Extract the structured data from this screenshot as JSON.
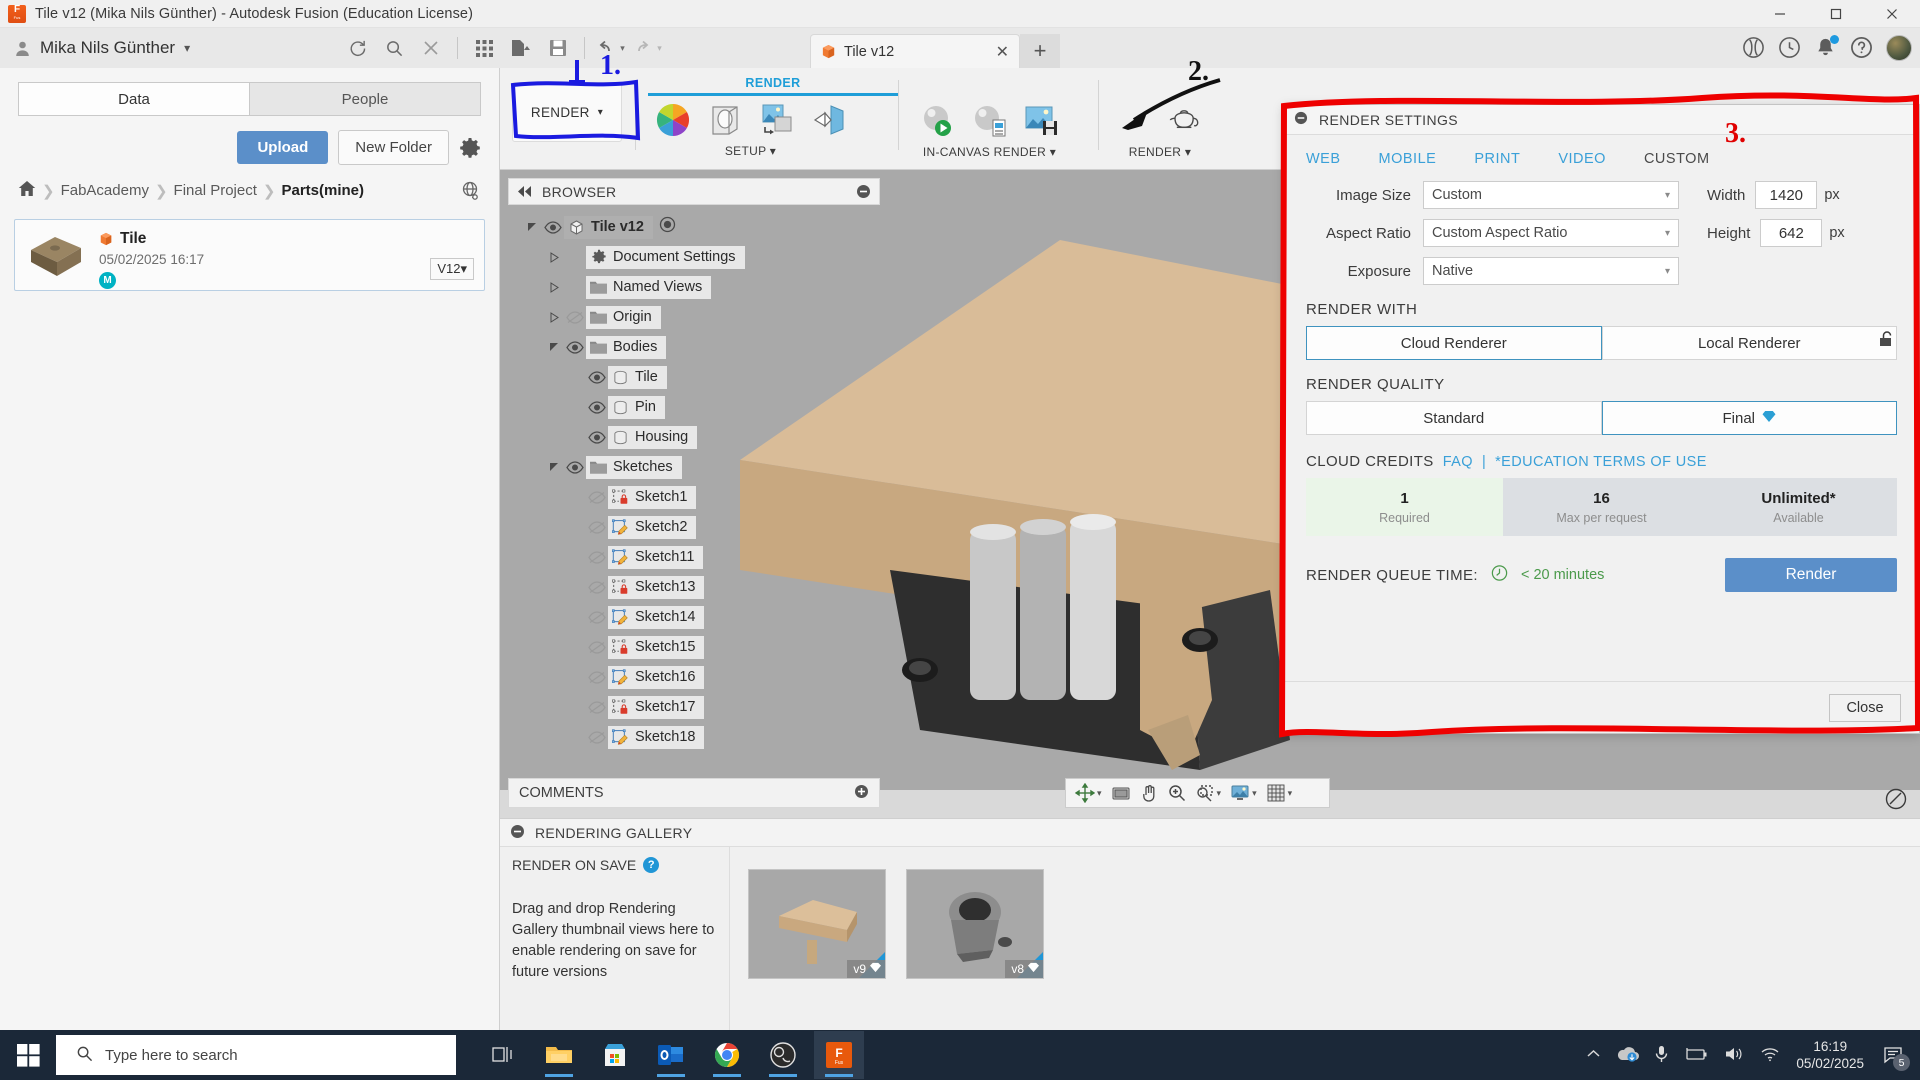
{
  "window": {
    "title": "Tile v12 (Mika Nils Günther) - Autodesk Fusion (Education License)",
    "minimize": "–",
    "maximize": "□",
    "close": "✕"
  },
  "apptop": {
    "user_name": "Mika Nils Günther",
    "quick_access": [
      {
        "name": "refresh-icon",
        "label": "Refresh"
      },
      {
        "name": "search-icon",
        "label": "Search"
      },
      {
        "name": "close-icon",
        "label": "Close"
      },
      {
        "name": "grid-icon",
        "label": "Grid"
      },
      {
        "name": "new-file-icon",
        "label": "New File"
      },
      {
        "name": "save-icon",
        "label": "Save"
      },
      {
        "name": "undo-icon",
        "label": "Undo"
      },
      {
        "name": "redo-icon",
        "label": "Redo"
      }
    ],
    "doc_tab": "Tile v12",
    "tab_close": "✕",
    "tab_add": "+",
    "right_icons": [
      {
        "name": "extensions-icon"
      },
      {
        "name": "recent-icon"
      },
      {
        "name": "notifications-icon"
      },
      {
        "name": "help-icon"
      },
      {
        "name": "account-avatar"
      }
    ]
  },
  "ribbon": {
    "workspace": "RENDER",
    "workspace_caret": "▾",
    "tab_label": "RENDER",
    "groups": [
      {
        "name": "setup",
        "label": "SETUP",
        "caret": "▾",
        "items": [
          "appearance-icon",
          "scene-settings-icon",
          "texture-map-controls-icon",
          "decal-icon"
        ]
      },
      {
        "name": "in-canvas-render",
        "label": "IN-CANVAS RENDER",
        "caret": "▾",
        "items": [
          "in-canvas-render-icon",
          "in-canvas-render-settings-icon",
          "capture-image-icon"
        ]
      },
      {
        "name": "render",
        "label": "RENDER",
        "caret": "▾",
        "items": [
          "render-teapot-icon"
        ]
      }
    ]
  },
  "data_panel": {
    "tabs": [
      {
        "label": "Data",
        "active": true
      },
      {
        "label": "People",
        "active": false
      }
    ],
    "upload_label": "Upload",
    "new_folder_label": "New Folder",
    "settings_icon": "gear-icon",
    "breadcrumb": {
      "home_icon": "home-icon",
      "separator": "❯",
      "items": [
        "FabAcademy",
        "Final Project",
        "Parts(mine)"
      ],
      "globe_icon": "globe-icon"
    },
    "file": {
      "name": "Tile",
      "date": "05/02/2025 16:17",
      "avatar_initial": "M",
      "version": "V12",
      "version_caret": "▾"
    }
  },
  "browser": {
    "title": "BROWSER",
    "collapse_left_icon": "collapse-left-icon",
    "minimize_icon": "minimize-icon",
    "tree": [
      {
        "label": "Tile v12",
        "indent": 0,
        "expander": "expanded",
        "eye": "visible",
        "icon": "component-icon",
        "root": true,
        "radio": true
      },
      {
        "label": "Document Settings",
        "indent": 1,
        "expander": "collapsed",
        "eye": "none",
        "icon": "gear-icon"
      },
      {
        "label": "Named Views",
        "indent": 1,
        "expander": "collapsed",
        "eye": "none",
        "icon": "folder-icon"
      },
      {
        "label": "Origin",
        "indent": 1,
        "expander": "collapsed",
        "eye": "hidden",
        "icon": "folder-icon"
      },
      {
        "label": "Bodies",
        "indent": 1,
        "expander": "expanded",
        "eye": "visible",
        "icon": "folder-icon"
      },
      {
        "label": "Tile",
        "indent": 2,
        "expander": "none",
        "eye": "visible",
        "icon": "body-icon"
      },
      {
        "label": "Pin",
        "indent": 2,
        "expander": "none",
        "eye": "visible",
        "icon": "body-icon"
      },
      {
        "label": "Housing",
        "indent": 2,
        "expander": "none",
        "eye": "visible",
        "icon": "body-icon"
      },
      {
        "label": "Sketches",
        "indent": 1,
        "expander": "expanded",
        "eye": "visible",
        "icon": "folder-icon"
      },
      {
        "label": "Sketch1",
        "indent": 2,
        "expander": "none",
        "eye": "hidden",
        "icon": "sketch-locked-icon"
      },
      {
        "label": "Sketch2",
        "indent": 2,
        "expander": "none",
        "eye": "hidden",
        "icon": "sketch-edit-icon"
      },
      {
        "label": "Sketch11",
        "indent": 2,
        "expander": "none",
        "eye": "hidden",
        "icon": "sketch-edit-icon"
      },
      {
        "label": "Sketch13",
        "indent": 2,
        "expander": "none",
        "eye": "hidden",
        "icon": "sketch-locked-icon"
      },
      {
        "label": "Sketch14",
        "indent": 2,
        "expander": "none",
        "eye": "hidden",
        "icon": "sketch-edit-icon"
      },
      {
        "label": "Sketch15",
        "indent": 2,
        "expander": "none",
        "eye": "hidden",
        "icon": "sketch-locked-icon"
      },
      {
        "label": "Sketch16",
        "indent": 2,
        "expander": "none",
        "eye": "hidden",
        "icon": "sketch-edit-icon"
      },
      {
        "label": "Sketch17",
        "indent": 2,
        "expander": "none",
        "eye": "hidden",
        "icon": "sketch-locked-icon"
      },
      {
        "label": "Sketch18",
        "indent": 2,
        "expander": "none",
        "eye": "hidden",
        "icon": "sketch-edit-icon"
      }
    ]
  },
  "comments": {
    "title": "COMMENTS",
    "expand_icon": "plus-icon"
  },
  "navbar": {
    "items": [
      {
        "name": "orbit-icon",
        "caret": "▾"
      },
      {
        "name": "look-at-icon",
        "caret": ""
      },
      {
        "name": "pan-icon",
        "caret": ""
      },
      {
        "name": "zoom-icon",
        "caret": ""
      },
      {
        "name": "zoom-window-icon",
        "caret": "▾"
      },
      {
        "name": "display-settings-icon",
        "caret": "▾"
      },
      {
        "name": "grid-snap-icon",
        "caret": "▾"
      }
    ]
  },
  "gallery": {
    "title": "RENDERING GALLERY",
    "minimize_icon": "minimize-icon",
    "render_on_save_label": "RENDER ON SAVE",
    "help_icon": "?",
    "hint": "Drag and drop Rendering Gallery thumbnail views here to enable rendering on save for future versions",
    "thumbnails": [
      {
        "version": "v9",
        "gem": "gem-icon"
      },
      {
        "version": "v8",
        "gem": "gem-icon"
      }
    ]
  },
  "render_dialog": {
    "title": "RENDER SETTINGS",
    "minimize_icon": "minimize-icon",
    "tabs": [
      {
        "label": "WEB",
        "current": false
      },
      {
        "label": "MOBILE",
        "current": false
      },
      {
        "label": "PRINT",
        "current": false
      },
      {
        "label": "VIDEO",
        "current": false
      },
      {
        "label": "CUSTOM",
        "current": true
      }
    ],
    "fields": {
      "image_size_label": "Image Size",
      "image_size_value": "Custom",
      "aspect_ratio_label": "Aspect Ratio",
      "aspect_ratio_value": "Custom Aspect Ratio",
      "exposure_label": "Exposure",
      "exposure_value": "Native",
      "width_label": "Width",
      "width_value": "1420",
      "width_unit": "px",
      "height_label": "Height",
      "height_value": "642",
      "height_unit": "px",
      "caret": "▾",
      "lock_icon": "unlock-icon"
    },
    "render_with": {
      "title": "RENDER WITH",
      "options": [
        {
          "label": "Cloud Renderer",
          "selected": true
        },
        {
          "label": "Local Renderer",
          "selected": false
        }
      ]
    },
    "render_quality": {
      "title": "RENDER QUALITY",
      "options": [
        {
          "label": "Standard",
          "selected": false,
          "gem": false
        },
        {
          "label": "Final",
          "selected": true,
          "gem": true
        }
      ]
    },
    "cloud_credits": {
      "title": "CLOUD CREDITS",
      "faq_link": "FAQ",
      "divider": "|",
      "terms_link": "*EDUCATION TERMS OF USE",
      "cells": [
        {
          "value": "1",
          "label": "Required",
          "style": "green"
        },
        {
          "value": "16",
          "label": "Max per request",
          "style": "gray"
        },
        {
          "value": "Unlimited*",
          "label": "Available",
          "style": "gray"
        }
      ]
    },
    "queue": {
      "label": "RENDER QUEUE TIME:",
      "clock_icon": "clock-icon",
      "value": "< 20 minutes"
    },
    "render_button": "Render",
    "close_button": "Close"
  },
  "annotations": [
    {
      "id": "1",
      "color": "#1a1ae0",
      "shape": "blue-box-around-render-workspace"
    },
    {
      "id": "2",
      "color": "#111111",
      "shape": "black-arrow-to-render-teapot"
    },
    {
      "id": "3",
      "color": "#e00000",
      "shape": "red-box-around-render-settings-dialog"
    }
  ],
  "taskbar": {
    "start_icon": "windows-start-icon",
    "search_placeholder": "Type here to search",
    "search_icon": "search-icon",
    "apps": [
      {
        "name": "task-view-icon",
        "active": false
      },
      {
        "name": "file-explorer-icon",
        "active": false,
        "running": true
      },
      {
        "name": "microsoft-store-icon",
        "active": false
      },
      {
        "name": "outlook-icon",
        "active": false,
        "running": true
      },
      {
        "name": "chrome-icon",
        "active": false,
        "running": true
      },
      {
        "name": "obs-icon",
        "active": false,
        "running": true
      },
      {
        "name": "fusion-icon",
        "active": true,
        "running": true
      }
    ],
    "tray": [
      {
        "name": "show-hidden-icons-icon"
      },
      {
        "name": "onedrive-icon"
      },
      {
        "name": "microphone-icon"
      },
      {
        "name": "battery-icon"
      },
      {
        "name": "volume-icon"
      },
      {
        "name": "wifi-icon"
      }
    ],
    "time": "16:19",
    "date": "05/02/2025",
    "notification_count": "5",
    "notification_icon": "action-center-icon"
  }
}
